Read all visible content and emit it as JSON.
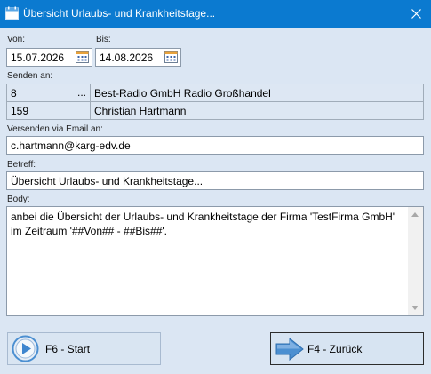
{
  "window": {
    "title": "Übersicht Urlaubs- und Krankheitstage..."
  },
  "dates": {
    "von_label": "Von:",
    "von_value": "15.07.2026",
    "bis_label": "Bis:",
    "bis_value": "14.08.2026"
  },
  "recipients": {
    "label": "Senden an:",
    "rows": [
      {
        "id": "8",
        "dots": "...",
        "name": "Best-Radio GmbH Radio Großhandel"
      },
      {
        "id": "159",
        "name": "Christian Hartmann"
      }
    ]
  },
  "email": {
    "label": "Versenden via Email an:",
    "value": "c.hartmann@karg-edv.de"
  },
  "subject": {
    "label": "Betreff:",
    "value": "Übersicht Urlaubs- und Krankheitstage..."
  },
  "body": {
    "label": "Body:",
    "value": "anbei die Übersicht der Urlaubs- und Krankheitstage der Firma 'TestFirma GmbH'\nim Zeitraum '##Von## - ##Bis##'."
  },
  "buttons": {
    "start_prefix": "F6 - ",
    "start_key": "S",
    "start_rest": "tart",
    "back_prefix": "F4 - ",
    "back_key": "Z",
    "back_rest": "urück"
  },
  "colors": {
    "titlebar": "#0b7ad0",
    "background": "#dbe6f3",
    "arrow": "#4b8fd1"
  },
  "icons": {
    "app": "calendar-app-icon",
    "close": "close-icon",
    "calendar": "calendar-icon",
    "start": "play-circle-icon",
    "back": "arrow-right-icon"
  }
}
